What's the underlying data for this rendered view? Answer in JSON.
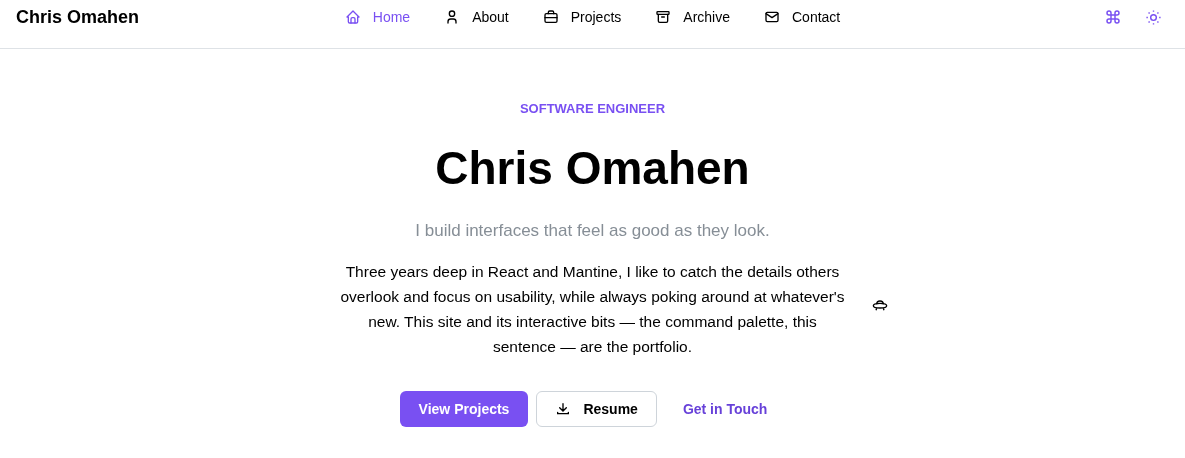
{
  "brand": "Chris Omahen",
  "nav": [
    {
      "label": "Home",
      "kind": "home",
      "selected": true
    },
    {
      "label": "About",
      "kind": "user",
      "selected": false
    },
    {
      "label": "Projects",
      "kind": "briefcase",
      "selected": false
    },
    {
      "label": "Archive",
      "kind": "archive",
      "selected": false
    },
    {
      "label": "Contact",
      "kind": "mail",
      "selected": false
    }
  ],
  "hero": {
    "eyebrow": "SOFTWARE ENGINEER",
    "title": "Chris Omahen",
    "tagline": "I build interfaces that feel as good as they look.",
    "bio": "Three years deep in React and Mantine, I like to catch the details others overlook and focus on usability, while always poking around at whatever's new. This site and its interactive bits — the command palette, this sentence — are the portfolio.",
    "buttons": [
      {
        "label": "View Projects",
        "kind": "primary"
      },
      {
        "label": "Resume",
        "kind": "outline"
      },
      {
        "label": "Get in Touch",
        "kind": "link"
      }
    ]
  }
}
